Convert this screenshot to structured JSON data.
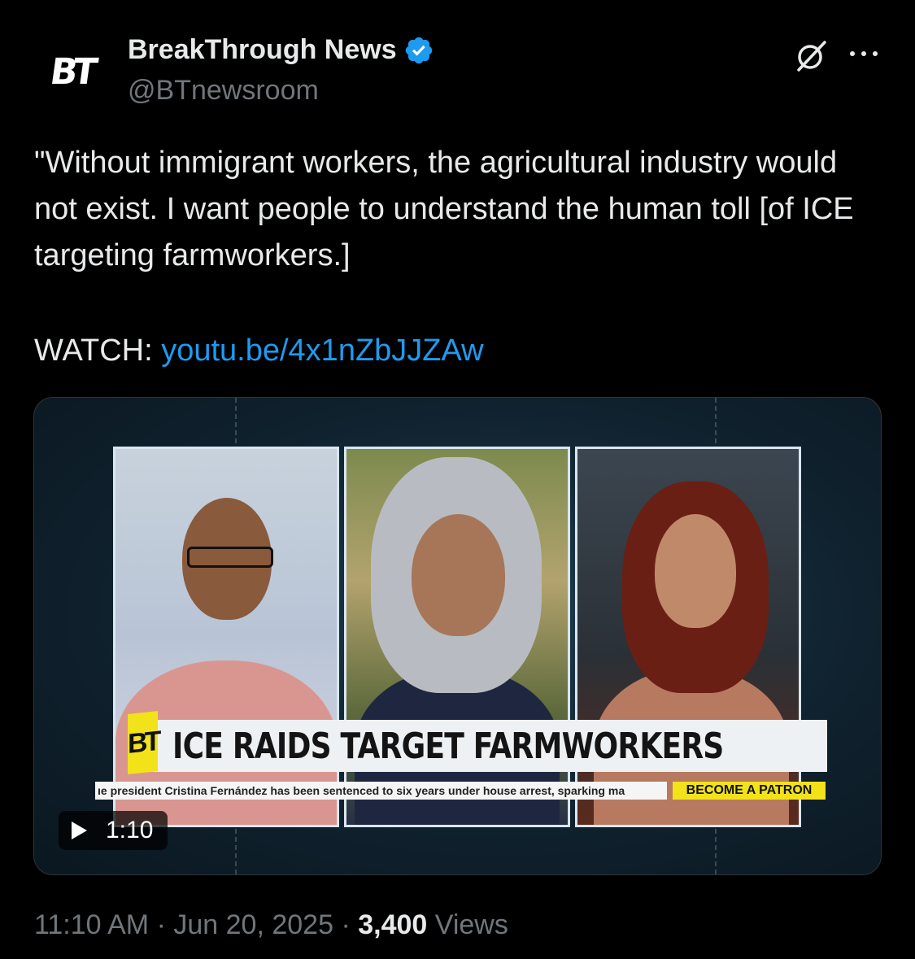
{
  "account": {
    "avatar_text": "BT",
    "name": "BreakThrough News",
    "handle": "@BTnewsroom",
    "verified": true
  },
  "tweet": {
    "text": "\"Without immigrant workers, the agricultural industry would not exist. I want people to understand the human toll [of ICE targeting farmworkers.]",
    "watch_label": "WATCH: ",
    "link": "youtu.be/4x1nZbJJZAw"
  },
  "video": {
    "banner_logo": "BT",
    "banner_title": "ICE RAIDS TARGET FARMWORKERS",
    "ticker": "ıe president Cristina Fernández has been sentenced to six years under house arrest, sparking ma",
    "patron_label": "BECOME A PATRON",
    "duration": "1:10"
  },
  "meta": {
    "time": "11:10 AM",
    "date": "Jun 20, 2025",
    "separator": "·",
    "views_count": "3,400",
    "views_label": "Views"
  },
  "colors": {
    "accent": "#1d9bf0",
    "muted": "#71767b",
    "banner_yellow": "#f2e21a"
  },
  "icons": [
    "verified-badge-icon",
    "grok-icon",
    "more-options-icon",
    "play-icon"
  ]
}
